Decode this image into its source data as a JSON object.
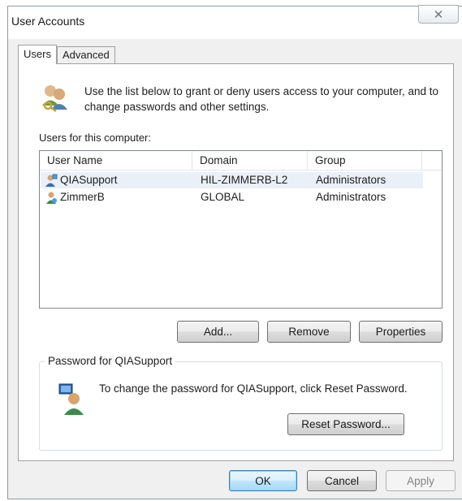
{
  "window": {
    "title": "User Accounts",
    "close_glyph": "✕"
  },
  "tabs": [
    {
      "label": "Users",
      "active": true
    },
    {
      "label": "Advanced",
      "active": false
    }
  ],
  "intro": {
    "icon": "users-icon",
    "text": "Use the list below to grant or deny users access to your computer, and to change passwords and other settings."
  },
  "users_list": {
    "label": "Users for this computer:",
    "columns": [
      "User Name",
      "Domain",
      "Group"
    ],
    "rows": [
      {
        "name": "QIASupport",
        "domain": "HIL-ZIMMERB-L2",
        "group": "Administrators",
        "icon": "admin-user-icon",
        "selected": true
      },
      {
        "name": "ZimmerB",
        "domain": "GLOBAL",
        "group": "Administrators",
        "icon": "domain-user-icon",
        "selected": false
      }
    ]
  },
  "list_buttons": {
    "add": "Add...",
    "remove": "Remove",
    "properties": "Properties"
  },
  "password_group": {
    "legend": "Password for QIASupport",
    "icon": "user-password-icon",
    "text": "To change the password for QIASupport, click Reset Password.",
    "reset_button": "Reset Password..."
  },
  "dialog_buttons": {
    "ok": "OK",
    "cancel": "Cancel",
    "apply": "Apply"
  },
  "colors": {
    "selection": "#e9f0f8",
    "default_button_border": "#3c7fb1",
    "window_bg": "#f0f0f0"
  }
}
